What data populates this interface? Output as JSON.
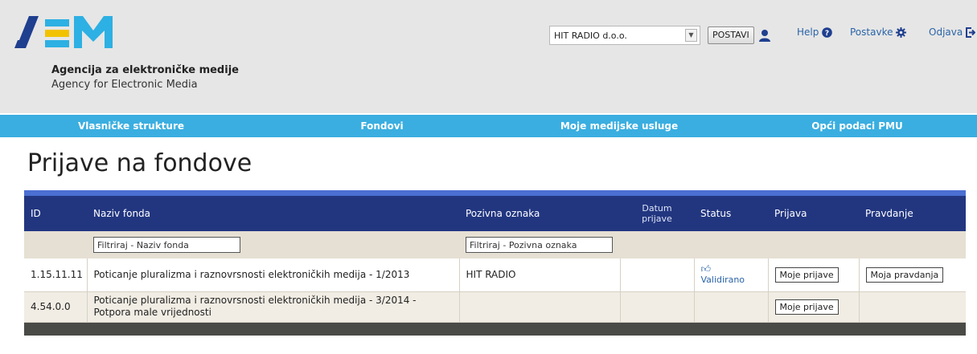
{
  "header": {
    "agency_name_hr": "Agencija za elektroničke medije",
    "agency_name_en": "Agency for Electronic Media",
    "company_select": {
      "selected": "HIT RADIO d.o.o."
    },
    "postavi_label": "POSTAVI",
    "links": {
      "help": "Help",
      "postavke": "Postavke",
      "odjava": "Odjava"
    }
  },
  "nav": {
    "items": [
      {
        "label": "Vlasničke strukture"
      },
      {
        "label": "Fondovi"
      },
      {
        "label": "Moje medijske usluge"
      },
      {
        "label": "Opći podaci PMU"
      }
    ]
  },
  "page": {
    "title": "Prijave na fondove"
  },
  "table": {
    "columns": [
      "ID",
      "Naziv fonda",
      "Pozivna oznaka",
      "Datum prijave",
      "Status",
      "Prijava",
      "Pravdanje"
    ],
    "filters": {
      "naziv_placeholder": "Filtriraj - Naziv fonda",
      "pozivna_placeholder": "Filtriraj - Pozivna oznaka"
    },
    "rows": [
      {
        "id": "1.15.11.11",
        "naziv": "Poticanje pluralizma i raznovrsnosti elektroničkih medija - 1/2013",
        "pozivna": "HIT RADIO",
        "datum": "",
        "status": "Validirano",
        "prijava": "Moje prijave",
        "pravdanje": "Moja pravdanja"
      },
      {
        "id": "4.54.0.0",
        "naziv": "Poticanje pluralizma i raznovrsnosti elektroničkih medija - 3/2014 - Potpora male vrijednosti",
        "pozivna": "",
        "datum": "",
        "status": "",
        "prijava": "Moje prijave",
        "pravdanje": ""
      }
    ]
  },
  "colors": {
    "nav_bg": "#3aaee0",
    "table_header": "#223680",
    "link": "#2a64a8",
    "logo_blue": "#1f3f8f",
    "logo_cyan": "#2db0e3",
    "logo_yellow": "#f2c200"
  }
}
